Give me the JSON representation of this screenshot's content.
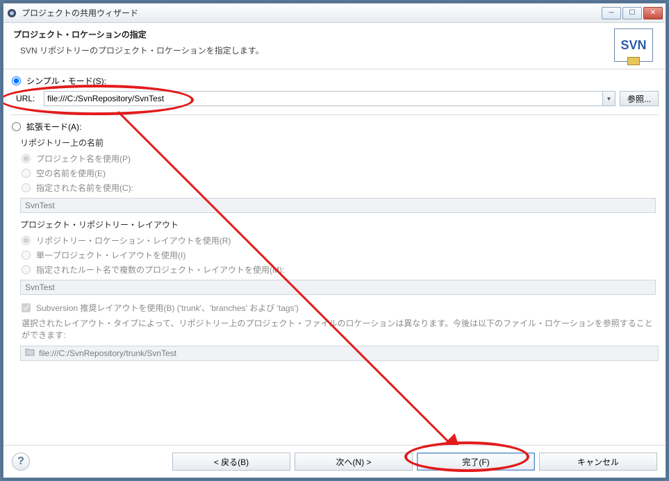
{
  "window": {
    "title": "プロジェクトの共用ウィザード"
  },
  "header": {
    "title": "プロジェクト・ロケーションの指定",
    "subtitle": "SVN リポジトリーのプロジェクト・ロケーションを指定します。",
    "banner_text": "SVN"
  },
  "simple_mode": {
    "label": "シンプル・モード(S):",
    "selected": true,
    "url_label": "URL:",
    "url_value": "file:///C:/SvnRepository/SvnTest",
    "browse_label": "参照..."
  },
  "advanced_mode": {
    "label": "拡張モード(A):",
    "selected": false,
    "repo_name": {
      "title": "リポジトリー上の名前",
      "options": {
        "use_project_name": {
          "label": "プロジェクト名を使用(P)",
          "selected": true
        },
        "use_empty_name": {
          "label": "空の名前を使用(E)",
          "selected": false
        },
        "use_specified": {
          "label": "指定された名前を使用(C):",
          "selected": false
        }
      },
      "value": "SvnTest"
    },
    "layout": {
      "title": "プロジェクト・リポジトリー・レイアウト",
      "options": {
        "use_location_layout": {
          "label": "リポジトリー・ロケーション・レイアウトを使用(R)",
          "selected": true
        },
        "use_single_project": {
          "label": "単一プロジェクト・レイアウトを使用(I)",
          "selected": false
        },
        "use_multi_root": {
          "label": "指定されたルート名で複数のプロジェクト・レイアウトを使用(M):",
          "selected": false
        }
      },
      "value": "SvnTest",
      "recommended_checkbox": {
        "label": "Subversion 推奨レイアウトを使用(B) ('trunk'、'branches' および 'tags')",
        "checked": true
      },
      "note": "選択されたレイアウト・タイプによって、リポジトリー上のプロジェクト・ファイルのロケーションは異なります。今後は以下のファイル・ロケーションを参照することができます:",
      "preview_path": "file:///C:/SvnRepository/trunk/SvnTest"
    }
  },
  "footer": {
    "back": "< 戻る(B)",
    "next": "次へ(N) >",
    "finish": "完了(F)",
    "cancel": "キャンセル"
  },
  "annotations": {
    "ellipse_url": true,
    "ellipse_finish": true,
    "arrow_url_to_finish": true
  }
}
